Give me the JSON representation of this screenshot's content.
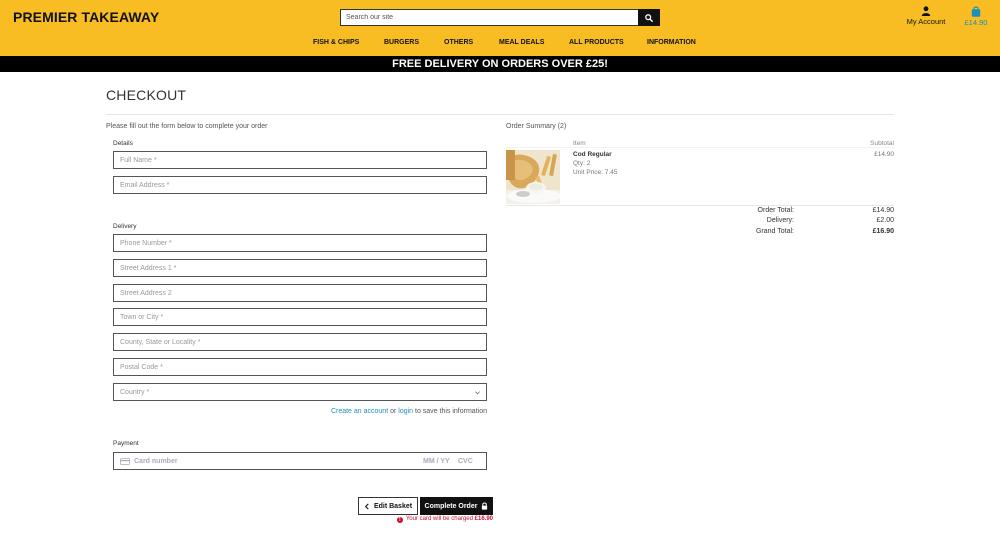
{
  "header": {
    "logo": "PREMIER TAKEAWAY",
    "search_placeholder": "Search our site",
    "account_label": "My Account",
    "basket_total": "£14.90"
  },
  "nav": {
    "items": [
      "FISH & CHIPS",
      "BURGERS",
      "OTHERS",
      "MEAL DEALS",
      "ALL PRODUCTS",
      "INFORMATION"
    ]
  },
  "banner": "FREE DELIVERY ON ORDERS OVER £25!",
  "checkout": {
    "title": "CHECKOUT",
    "intro": "Please fill out the form below to complete your order",
    "details_label": "Details",
    "full_name": "Full Name *",
    "email": "Email Address *",
    "delivery_label": "Delivery",
    "phone": "Phone Number *",
    "street1": "Street Address 1 *",
    "street2": "Street Address 2",
    "town": "Town or City *",
    "county": "County, State or Locality *",
    "postcode": "Postal Code *",
    "country": "Country *",
    "save_prefix": "Create an account",
    "save_or": " or ",
    "save_login": "login",
    "save_suffix": " to save this information",
    "payment_label": "Payment",
    "card_number": "Card number",
    "card_expiry": "MM / YY",
    "card_cvc": "CVC",
    "edit_basket": "Edit Basket",
    "complete_order": "Complete Order",
    "charge_text": "Your card will be charged ",
    "charge_amount": "£16.90"
  },
  "summary": {
    "title": "Order Summary (2)",
    "col_item": "Item",
    "col_subtotal": "Subtotal",
    "item_name": "Cod Regular",
    "item_qty": "Qty: 2",
    "item_unit": "Unit Price: 7.45",
    "item_subtotal": "£14.90",
    "order_total_label": "Order Total:",
    "order_total": "£14.90",
    "delivery_label": "Delivery:",
    "delivery": "£2.00",
    "grand_total_label": "Grand Total:",
    "grand_total": "£16.90"
  },
  "colors": {
    "brand_yellow": "#f7bd22",
    "link_blue": "#1d8fbf",
    "error_red": "#c8102e"
  }
}
